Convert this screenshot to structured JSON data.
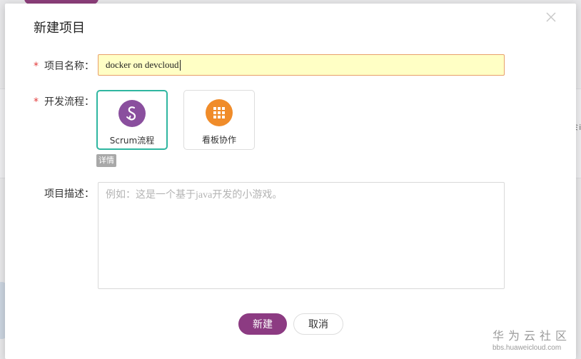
{
  "dialog": {
    "title": "新建项目",
    "close_icon": "close-icon"
  },
  "form": {
    "required_mark": "*",
    "name_label": "项目名称：",
    "name_value": "docker on devcloud",
    "flow_label": "开发流程：",
    "flows": [
      {
        "label": "Scrum流程",
        "icon": "scrum-icon",
        "color": "#8a4f9e",
        "selected": true
      },
      {
        "label": "看板协作",
        "icon": "kanban-grid-icon",
        "color": "#f08c2a",
        "selected": false
      }
    ],
    "detail_label": "详情",
    "desc_label": "项目描述：",
    "desc_placeholder": "例如：这是一个基于java开发的小游戏。"
  },
  "buttons": {
    "create": "新建",
    "cancel": "取消"
  },
  "background": {
    "edge_text": "ミi"
  },
  "watermark": {
    "title": "华为云社区",
    "url": "bbs.huaweicloud.com"
  },
  "colors": {
    "primary": "#8c3b82",
    "selected_border": "#2fb6a0",
    "input_highlight": "#ffffc5",
    "required": "#e23c3c"
  }
}
